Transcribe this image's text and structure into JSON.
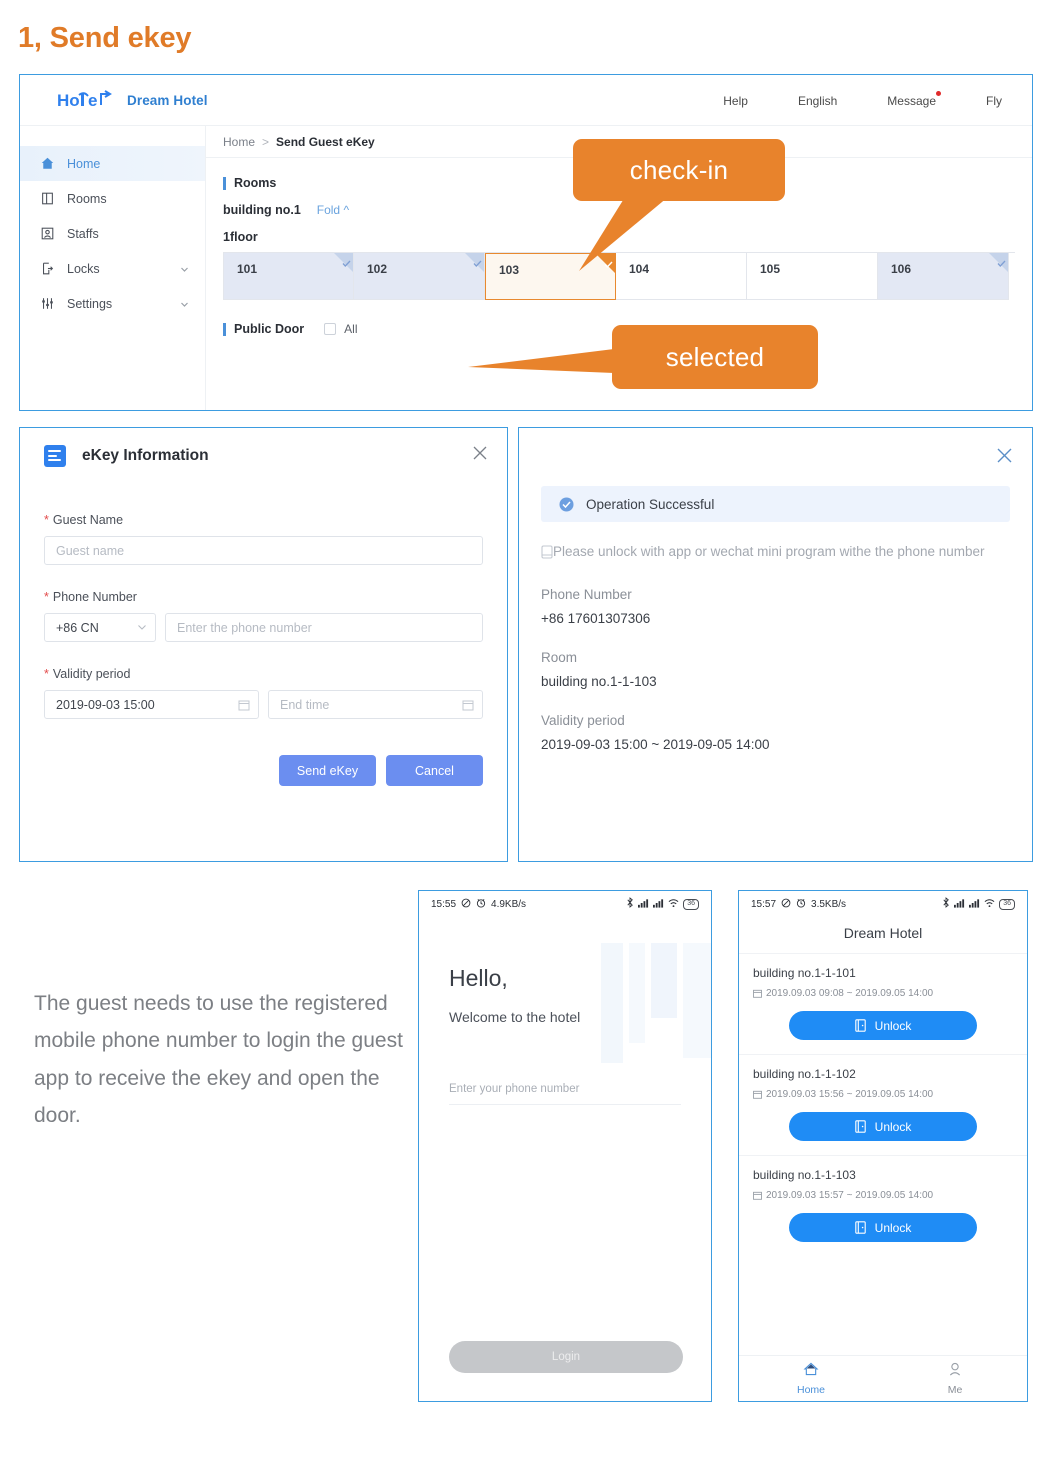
{
  "title": "1, Send ekey",
  "browser": {
    "logo_icon": "hotel-logo-icon",
    "brand": "Dream Hotel",
    "nav": [
      {
        "label": "Help",
        "badge": false
      },
      {
        "label": "English",
        "badge": false
      },
      {
        "label": "Message",
        "badge": true
      },
      {
        "label": "Fly",
        "badge": false
      }
    ],
    "sidebar": [
      {
        "label": "Home",
        "icon": "home-icon",
        "active": true,
        "chevron": false
      },
      {
        "label": "Rooms",
        "icon": "door-icon",
        "active": false,
        "chevron": false
      },
      {
        "label": "Staffs",
        "icon": "staff-icon",
        "active": false,
        "chevron": false
      },
      {
        "label": "Locks",
        "icon": "lock-icon",
        "active": false,
        "chevron": true
      },
      {
        "label": "Settings",
        "icon": "settings-icon",
        "active": false,
        "chevron": true
      }
    ],
    "breadcrumb": {
      "root": "Home",
      "separator": ">",
      "current": "Send Guest eKey"
    },
    "rooms_section_title": "Rooms",
    "building": "building no.1",
    "fold_label": "Fold",
    "floor_label": "1floor",
    "rooms": [
      {
        "number": "101",
        "state": "occupied"
      },
      {
        "number": "102",
        "state": "occupied"
      },
      {
        "number": "103",
        "state": "selected"
      },
      {
        "number": "104",
        "state": "free"
      },
      {
        "number": "105",
        "state": "free"
      },
      {
        "number": "106",
        "state": "occupied"
      }
    ],
    "public_door_title": "Public Door",
    "public_door_all": "All"
  },
  "callouts": {
    "check_in": "check-in",
    "selected": "selected",
    "color": "#e8832c"
  },
  "dialog": {
    "icon": "ekey-doc-icon",
    "title": "eKey Information",
    "close_icon": "close-icon",
    "guest_name_label": "Guest Name",
    "guest_name_placeholder": "Guest name",
    "phone_label": "Phone Number",
    "country_code": "+86 CN",
    "phone_placeholder": "Enter the phone number",
    "validity_label": "Validity period",
    "start_time": "2019-09-03 15:00",
    "end_time_placeholder": "End time",
    "send_label": "Send eKey",
    "cancel_label": "Cancel",
    "required_mark": "*"
  },
  "success": {
    "close_icon": "close-icon",
    "banner_icon": "check-circle-icon",
    "banner": "Operation Successful",
    "note": "Please unlock with app or wechat mini program withe the phone number",
    "phone_key": "Phone Number",
    "phone_value": "+86 17601307306",
    "room_key": "Room",
    "room_value": "building no.1-1-103",
    "validity_key": "Validity period",
    "validity_value": "2019-09-03 15:00  ~  2019-09-05 14:00"
  },
  "paragraph": "The guest needs to use the registered mobile phone number to login the guest app to receive the ekey and open the door.",
  "phone_login": {
    "status": {
      "time": "15:55",
      "net": "4.9KB/s",
      "battery": "36"
    },
    "hello": "Hello,",
    "welcome": "Welcome to the hotel",
    "input_placeholder": "Enter your phone number",
    "login_label": "Login"
  },
  "phone_keys": {
    "status": {
      "time": "15:57",
      "net": "3.5KB/s",
      "battery": "36"
    },
    "title": "Dream Hotel",
    "cards": [
      {
        "room": "building no.1-1-101",
        "time": "2019.09.03 09:08 ~ 2019.09.05 14:00",
        "unlock": "Unlock"
      },
      {
        "room": "building no.1-1-102",
        "time": "2019.09.03 15:56 ~ 2019.09.05 14:00",
        "unlock": "Unlock"
      },
      {
        "room": "building no.1-1-103",
        "time": "2019.09.03 15:57 ~ 2019.09.05 14:00",
        "unlock": "Unlock"
      }
    ],
    "tabs": [
      {
        "label": "Home",
        "icon": "home-icon",
        "active": true
      },
      {
        "label": "Me",
        "icon": "person-icon",
        "active": false
      }
    ]
  }
}
